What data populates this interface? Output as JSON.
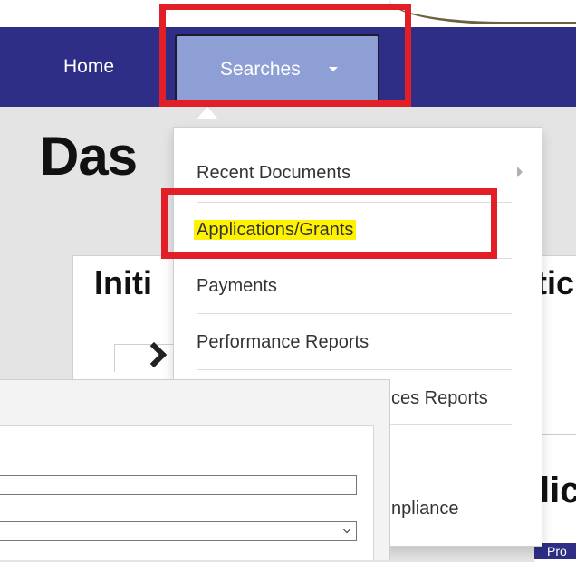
{
  "navbar": {
    "home_label": "Home",
    "searches_label": "Searches"
  },
  "page": {
    "title": "Das",
    "card_title_left": "Initi",
    "card_title_right": "tic",
    "lower_right_title": "lic",
    "blue_band_text": "Pro"
  },
  "dropdown": {
    "items": [
      {
        "label": "Recent Documents",
        "has_submenu": true
      },
      {
        "label": "Applications/Grants",
        "highlighted": true
      },
      {
        "label": "Payments"
      },
      {
        "label": "Performance Reports"
      },
      {
        "label": "ces Reports"
      },
      {
        "label": ""
      },
      {
        "label": "npliance"
      }
    ]
  },
  "colors": {
    "navbar": "#2e2e86",
    "searches_active": "#8e9fd6",
    "annotation_red": "#e21f26",
    "highlight_yellow": "#fff200"
  }
}
